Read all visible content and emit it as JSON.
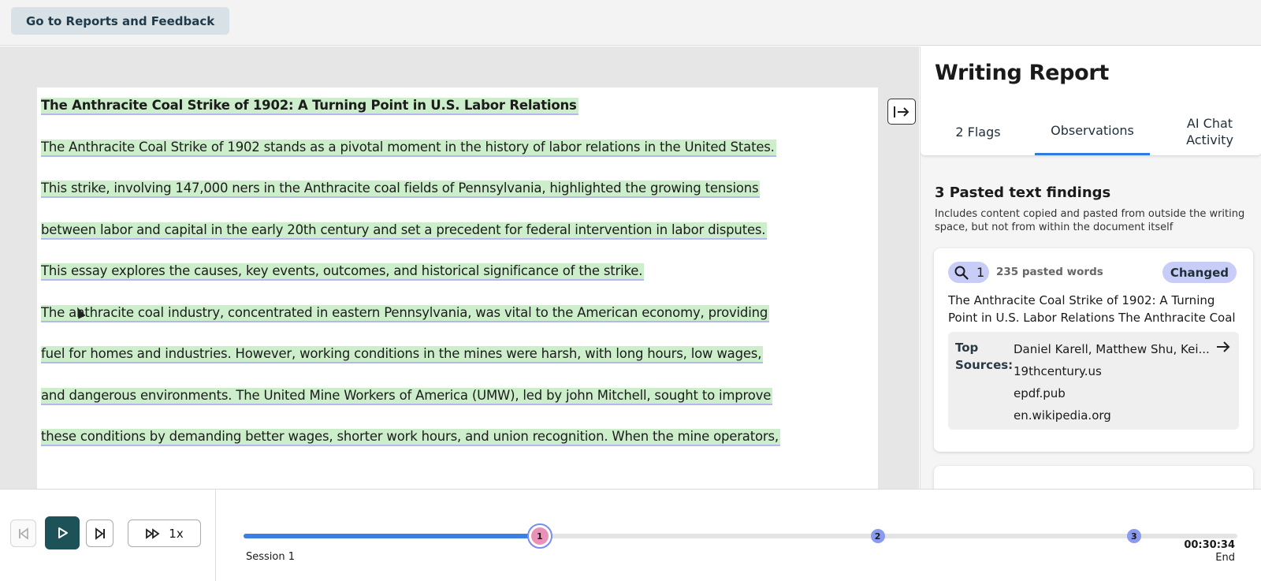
{
  "topbar": {
    "back_label": "Go to Reports and Feedback"
  },
  "document": {
    "lines": [
      "The Anthracite Coal Strike of 1902: A Turning Point in U.S. Labor Relations",
      "The Anthracite Coal Strike of 1902 stands as a pivotal moment in the history of labor relations in the United States.",
      "This strike, involving 147,000 ners in the Anthracite coal fields of Pennsylvania, highlighted the growing tensions",
      "between labor and capital in the early 20th century and set a precedent for federal intervention in labor disputes.",
      "This essay explores the causes, key events, outcomes, and historical significance of the strike.",
      "The anthracite coal industry, concentrated in eastern Pennsylvania, was vital to the American economy, providing",
      "fuel for homes and industries. However, working conditions in the mines were harsh, with long hours, low wages,",
      "and dangerous environments. The United Mine Workers of America (UMW), led by john Mitchell, sought to improve",
      "these conditions by demanding better wages, shorter work hours, and union recognition. When the mine operators,"
    ]
  },
  "report": {
    "title": "Writing Report",
    "tabs": [
      {
        "label": "2 Flags"
      },
      {
        "label": "Observations"
      },
      {
        "label": "AI Chat Activity"
      }
    ],
    "findings_title": "3 Pasted text findings",
    "findings_desc": "Includes content copied and pasted from outside the writing space, but not from within the document itself",
    "card": {
      "number": "1",
      "pasted_words": "235 pasted words",
      "badge": "Changed",
      "excerpt": "The Anthracite Coal Strike of 1902: A Turning Point in U.S. Labor Relations The Anthracite Coal Strike...",
      "sources_label": "Top Sources:",
      "sources": [
        "Daniel Karell, Matthew Shu, Kei...",
        "19thcentury.us",
        "epdf.pub",
        "en.wikipedia.org"
      ]
    }
  },
  "playback": {
    "speed_label": "1x",
    "progress_fraction": 0.295,
    "markers": [
      {
        "label": "1",
        "position": 0.298
      },
      {
        "label": "2",
        "position": 0.638
      },
      {
        "label": "3",
        "position": 0.896
      }
    ],
    "session_label": "Session 1",
    "time_label": "00:30:34",
    "end_label": "End"
  }
}
